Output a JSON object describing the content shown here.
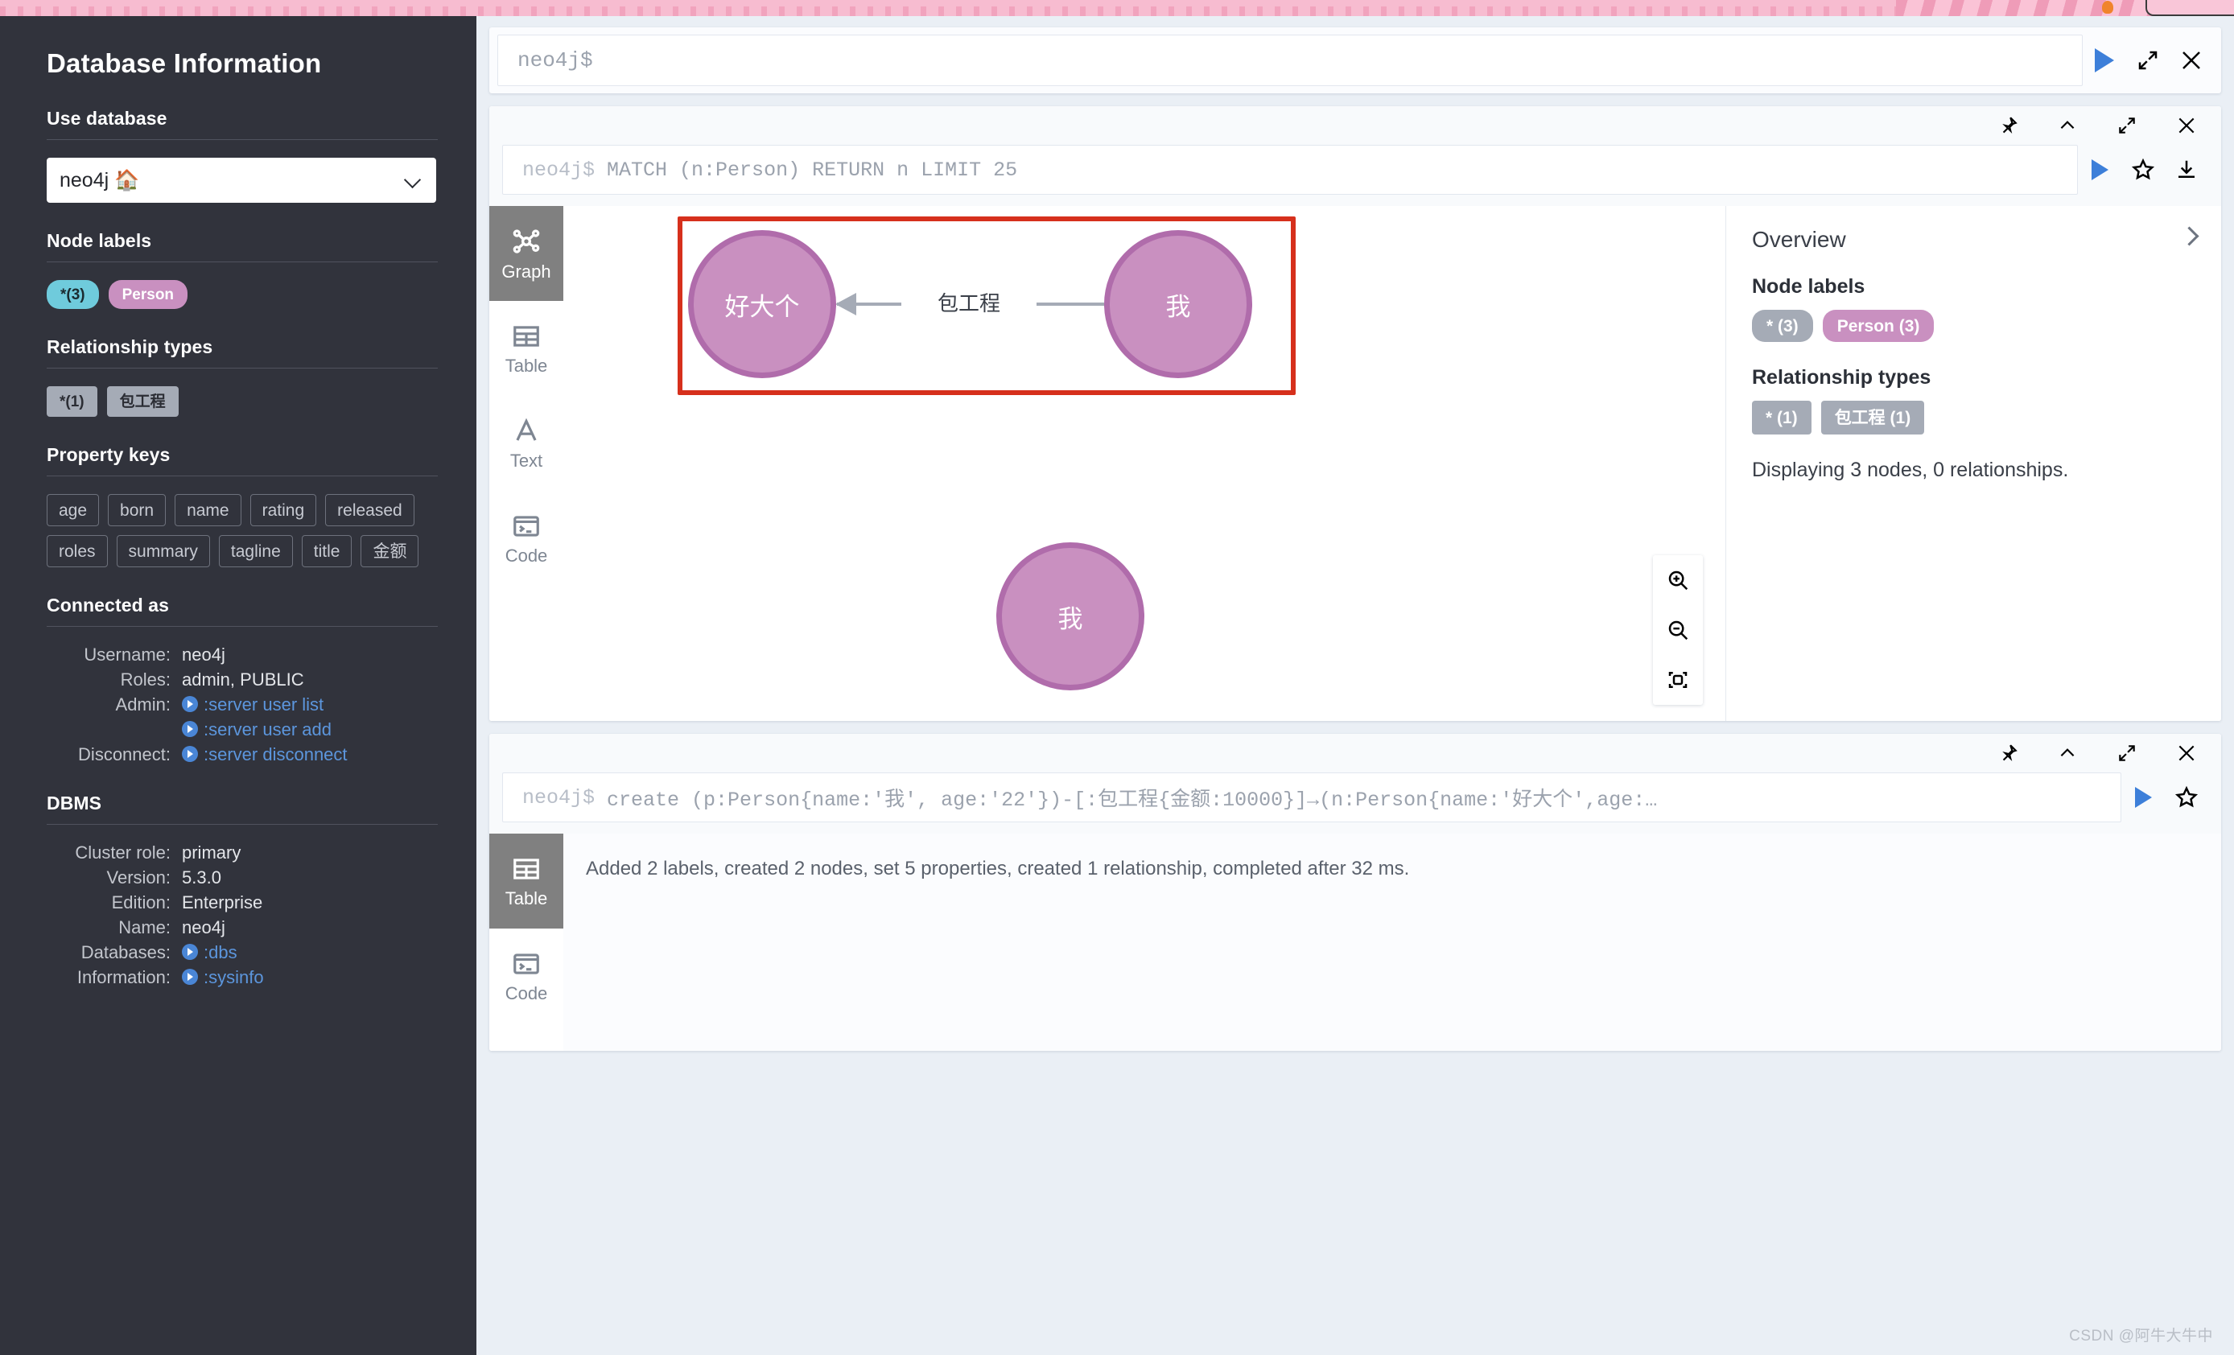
{
  "sidebar": {
    "title": "Database Information",
    "use_database": {
      "heading": "Use database",
      "selected": "neo4j 🏠"
    },
    "node_labels": {
      "heading": "Node labels",
      "chips": [
        {
          "label": "*(3)",
          "style": "blue"
        },
        {
          "label": "Person",
          "style": "purple"
        }
      ]
    },
    "relationship_types": {
      "heading": "Relationship types",
      "chips": [
        {
          "label": "*(1)"
        },
        {
          "label": "包工程"
        }
      ]
    },
    "property_keys": {
      "heading": "Property keys",
      "keys": [
        "age",
        "born",
        "name",
        "rating",
        "released",
        "roles",
        "summary",
        "tagline",
        "title",
        "金额"
      ]
    },
    "connected_as": {
      "heading": "Connected as",
      "rows": [
        {
          "key": "Username:",
          "value": "neo4j",
          "link": false
        },
        {
          "key": "Roles:",
          "value": "admin, PUBLIC",
          "link": false
        },
        {
          "key": "Admin:",
          "value": ":server user list",
          "link": true
        },
        {
          "key": "",
          "value": ":server user add",
          "link": true
        },
        {
          "key": "Disconnect:",
          "value": ":server disconnect",
          "link": true
        }
      ]
    },
    "dbms": {
      "heading": "DBMS",
      "rows": [
        {
          "key": "Cluster role:",
          "value": "primary",
          "link": false
        },
        {
          "key": "Version:",
          "value": "5.3.0",
          "link": false
        },
        {
          "key": "Edition:",
          "value": "Enterprise",
          "link": false
        },
        {
          "key": "Name:",
          "value": "neo4j",
          "link": false
        },
        {
          "key": "Databases:",
          "value": ":dbs",
          "link": true
        },
        {
          "key": "Information:",
          "value": ":sysinfo",
          "link": true
        }
      ]
    }
  },
  "editor": {
    "prompt": "neo4j$",
    "placeholder": "neo4j$"
  },
  "frame1": {
    "prompt": "neo4j$",
    "query": "MATCH (n:Person) RETURN n LIMIT 25",
    "view_tabs": [
      {
        "label": "Graph",
        "icon": "graph-icon",
        "active": true
      },
      {
        "label": "Table",
        "icon": "table-icon",
        "active": false
      },
      {
        "label": "Text",
        "icon": "text-icon",
        "active": false
      },
      {
        "label": "Code",
        "icon": "code-icon",
        "active": false
      }
    ],
    "overview": {
      "title": "Overview",
      "node_labels_heading": "Node labels",
      "node_labels": [
        {
          "label": "* (3)",
          "style": "gray"
        },
        {
          "label": "Person (3)",
          "style": "purple"
        }
      ],
      "relationship_heading": "Relationship types",
      "relationship_types": [
        {
          "label": "* (1)"
        },
        {
          "label": "包工程 (1)"
        }
      ],
      "status": "Displaying 3 nodes, 0 relationships."
    },
    "graph": {
      "nodes": [
        {
          "id": "n1",
          "caption": "好大个",
          "selected": true
        },
        {
          "id": "n2",
          "caption": "我",
          "selected": true
        },
        {
          "id": "n3",
          "caption": "我",
          "selected": false
        }
      ],
      "relationships": [
        {
          "from": "n2",
          "to": "n1",
          "type": "包工程"
        }
      ]
    },
    "zoom_controls": [
      {
        "name": "zoom-in-icon"
      },
      {
        "name": "zoom-out-icon"
      },
      {
        "name": "fit-to-screen-icon"
      }
    ]
  },
  "frame2": {
    "prompt": "neo4j$",
    "query": "create (p:Person{name:'我', age:'22'})-[:包工程{金额:10000}]→(n:Person{name:'好大个',age:…",
    "result_message": "Added 2 labels, created 2 nodes, set 5 properties, created 1 relationship, completed after 32 ms.",
    "view_tabs": [
      {
        "label": "Table",
        "icon": "table-icon",
        "active": true
      },
      {
        "label": "Code",
        "icon": "code-icon",
        "active": false
      }
    ]
  },
  "frame_head_icons": [
    {
      "name": "pin-icon"
    },
    {
      "name": "collapse-up-icon"
    },
    {
      "name": "fullscreen-icon"
    },
    {
      "name": "close-icon"
    }
  ],
  "query_row_icons": [
    {
      "name": "run-query-icon"
    },
    {
      "name": "favorite-star-icon"
    },
    {
      "name": "download-icon"
    }
  ],
  "editor_icons": [
    {
      "name": "run-icon"
    },
    {
      "name": "fullscreen-icon"
    },
    {
      "name": "close-icon"
    }
  ],
  "watermark": "CSDN @阿牛大牛中",
  "colors": {
    "sidebar_bg": "#31333c",
    "accent_blue": "#3d7fd9",
    "node_purple": "#c990c0",
    "node_border": "#b06cab",
    "selection_red": "#d6301c",
    "chip_gray": "#a5abb6",
    "chip_blue": "#6fcbdc"
  }
}
